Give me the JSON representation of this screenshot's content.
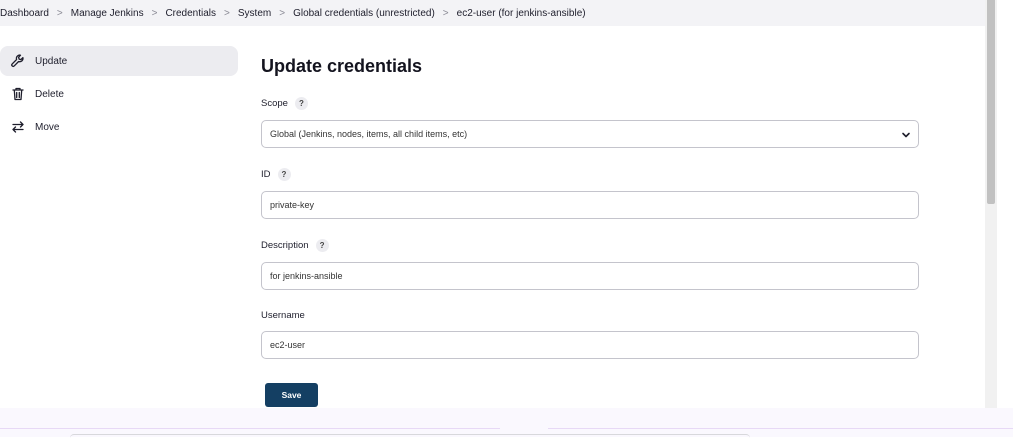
{
  "breadcrumb": {
    "items": [
      "Dashboard",
      "Manage Jenkins",
      "Credentials",
      "System",
      "Global credentials (unrestricted)",
      "ec2-user (for jenkins-ansible)"
    ],
    "separator": ">"
  },
  "sidebar": {
    "items": [
      {
        "label": "Update",
        "icon": "wrench-icon",
        "active": true
      },
      {
        "label": "Delete",
        "icon": "trash-icon",
        "active": false
      },
      {
        "label": "Move",
        "icon": "move-arrows-icon",
        "active": false
      }
    ]
  },
  "main": {
    "title": "Update credentials",
    "help": "?",
    "fields": {
      "scope": {
        "label": "Scope",
        "value": "Global (Jenkins, nodes, items, all child items, etc)"
      },
      "id": {
        "label": "ID",
        "value": "private-key"
      },
      "description": {
        "label": "Description",
        "value": "for jenkins-ansible"
      },
      "username": {
        "label": "Username",
        "value": "ec2-user"
      }
    },
    "save_label": "Save"
  },
  "colors": {
    "accent": "#143f63",
    "breadcrumb_bg": "#f3f3f6",
    "active_bg": "#ececf0"
  }
}
